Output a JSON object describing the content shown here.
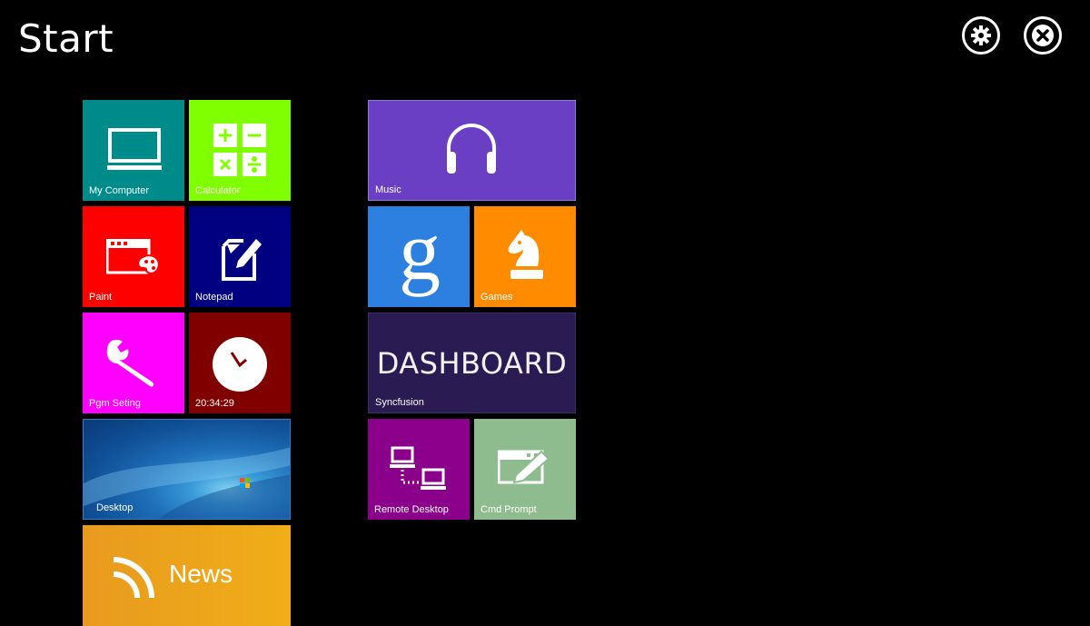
{
  "header": {
    "title": "Start"
  },
  "controls": {
    "settings_icon": "gear-icon",
    "close_icon": "close-circle-icon"
  },
  "tiles": {
    "my_computer": {
      "label": "My Computer",
      "color": "#008B8B",
      "icon": "monitor-icon"
    },
    "calculator": {
      "label": "Calculator",
      "color": "#80FF00",
      "icon": "calculator-icon"
    },
    "music": {
      "label": "Music",
      "color": "#6A3FC4",
      "icon": "headphones-icon"
    },
    "paint": {
      "label": "Paint",
      "color": "#FF0000",
      "icon": "paint-palette-icon"
    },
    "notepad": {
      "label": "Notepad",
      "color": "#000080",
      "icon": "notepad-edit-icon"
    },
    "google": {
      "label": "",
      "color": "#2D7FE0",
      "icon": "google-g-icon"
    },
    "games": {
      "label": "Games",
      "color": "#FF8C00",
      "icon": "chess-knight-icon"
    },
    "pgm_seting": {
      "label": "Pgm Seting",
      "color": "#FF00FF",
      "icon": "wrench-icon"
    },
    "clock": {
      "label": "20:34:29",
      "color": "#800000",
      "icon": "clock-icon"
    },
    "syncfusion": {
      "label": "Syncfusion",
      "color": "#2A1B52",
      "text": "DASHBOARD"
    },
    "desktop": {
      "label": "Desktop",
      "icon": "wallpaper-preview"
    },
    "remote_desktop": {
      "label": "Remote Desktop",
      "color": "#8B008B",
      "icon": "network-computers-icon"
    },
    "cmd_prompt": {
      "label": "Cmd Prompt",
      "color": "#8FBC8F",
      "icon": "console-window-icon"
    },
    "news": {
      "label": "News",
      "color": "#F0A020",
      "icon": "rss-icon"
    }
  }
}
